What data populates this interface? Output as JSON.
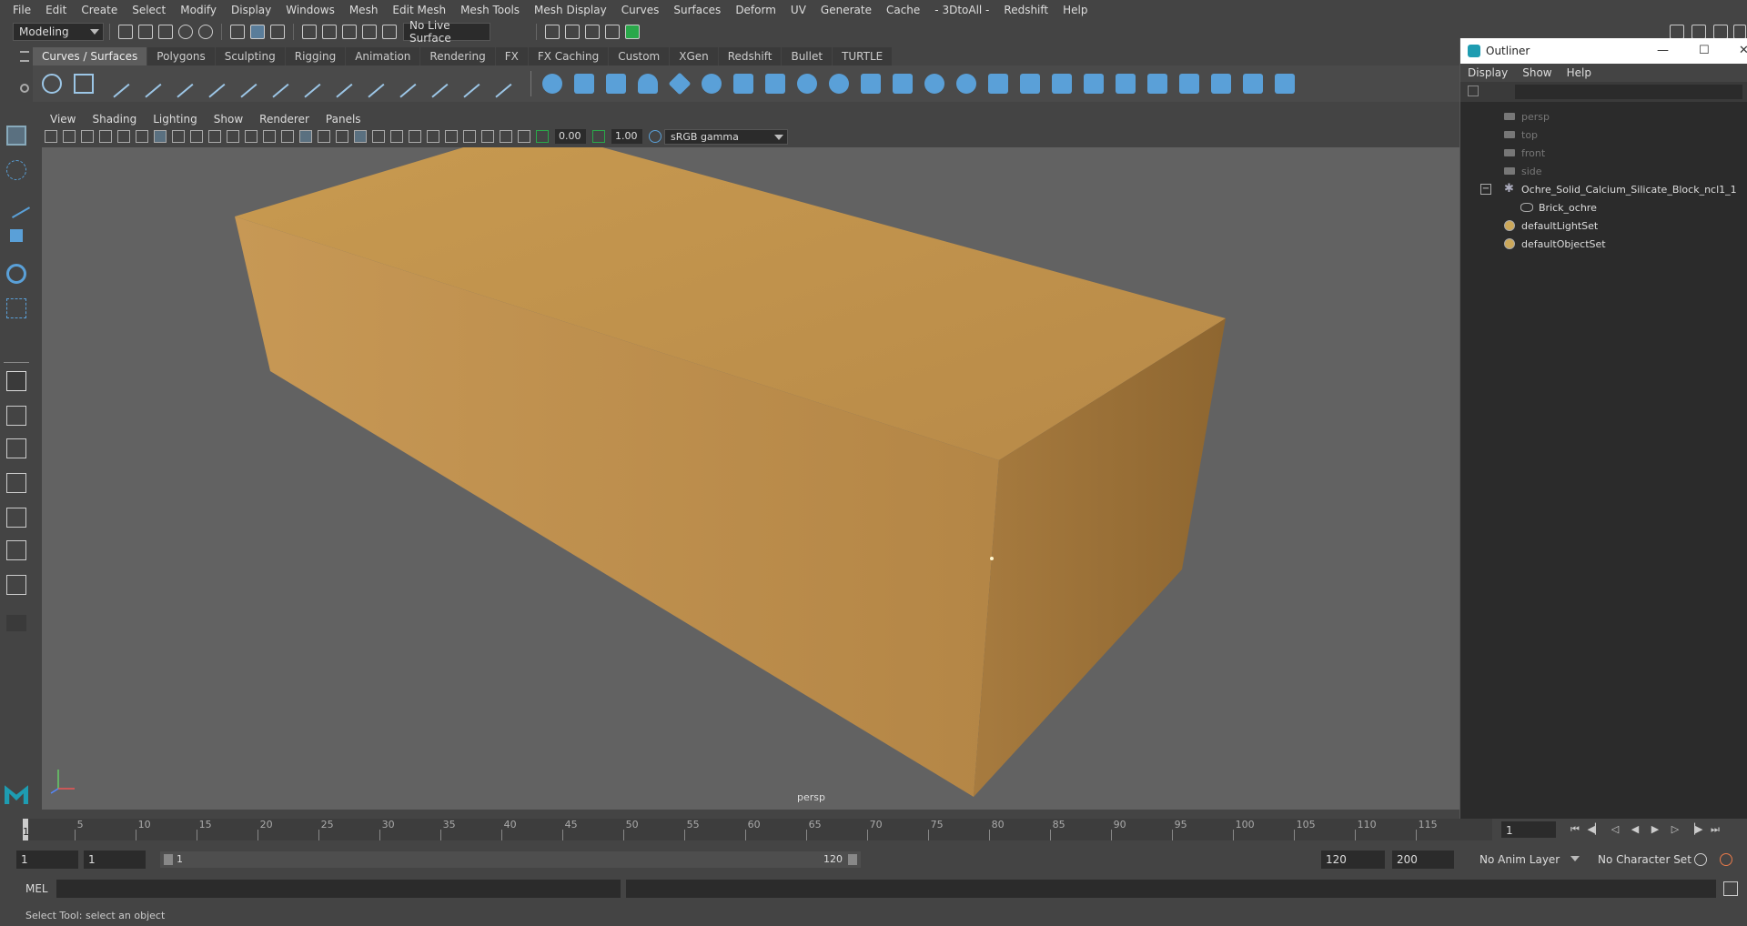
{
  "menus": [
    "File",
    "Edit",
    "Create",
    "Select",
    "Modify",
    "Display",
    "Windows",
    "Mesh",
    "Edit Mesh",
    "Mesh Tools",
    "Mesh Display",
    "Curves",
    "Surfaces",
    "Deform",
    "UV",
    "Generate",
    "Cache",
    "- 3DtoAll -",
    "Redshift",
    "Help"
  ],
  "status": {
    "mode": "Modeling",
    "live_surface": "No Live Surface"
  },
  "shelf": {
    "tabs": [
      "Curves / Surfaces",
      "Polygons",
      "Sculpting",
      "Rigging",
      "Animation",
      "Rendering",
      "FX",
      "FX Caching",
      "Custom",
      "XGen",
      "Redshift",
      "Bullet",
      "TURTLE"
    ],
    "active_tab": "Curves / Surfaces"
  },
  "panel": {
    "menus": [
      "View",
      "Shading",
      "Lighting",
      "Show",
      "Renderer",
      "Panels"
    ],
    "exposure": "0.00",
    "gamma": "1.00",
    "color_space": "sRGB gamma",
    "camera_label": "persp"
  },
  "outliner": {
    "title": "Outliner",
    "menus": [
      "Display",
      "Show",
      "Help"
    ],
    "items": [
      {
        "label": "persp"
      },
      {
        "label": "top"
      },
      {
        "label": "front"
      },
      {
        "label": "side"
      },
      {
        "label": "Ochre_Solid_Calcium_Silicate_Block_ncl1_1"
      },
      {
        "label": "Brick_ochre"
      },
      {
        "label": "defaultLightSet"
      },
      {
        "label": "defaultObjectSet"
      }
    ]
  },
  "timeline": {
    "ticks": [
      "5",
      "10",
      "15",
      "20",
      "25",
      "30",
      "35",
      "40",
      "45",
      "50",
      "55",
      "60",
      "65",
      "70",
      "75",
      "80",
      "85",
      "90",
      "95",
      "100",
      "105",
      "110",
      "115"
    ],
    "start_frame_marker": "1",
    "current_frame": "1"
  },
  "range": {
    "start": "1",
    "playback_start": "1",
    "slider_start": "1",
    "slider_end": "120",
    "playback_end": "120",
    "end": "200",
    "anim_layer": "No Anim Layer",
    "character_set": "No Character Set"
  },
  "command": {
    "language": "MEL"
  },
  "help_line": "Select Tool: select an object"
}
